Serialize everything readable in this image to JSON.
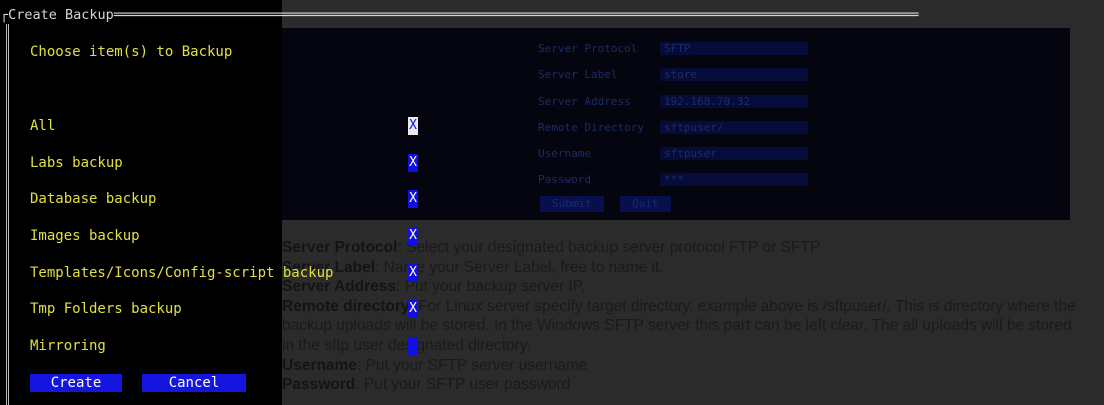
{
  "dialog": {
    "title_bar": "┌Create Backup═══════════════════════════════════════════════════════════════════════════════════════════════════",
    "heading": "Choose item(s) to Backup",
    "items": [
      {
        "label": "All",
        "mark": "X"
      },
      {
        "label": "Labs backup",
        "mark": "X"
      },
      {
        "label": "Database backup",
        "mark": "X"
      },
      {
        "label": "Images backup",
        "mark": "X"
      },
      {
        "label": "Templates/Icons/Config-script backup",
        "mark": "X"
      },
      {
        "label": "Tmp Folders backup",
        "mark": "X"
      },
      {
        "label": "Mirroring",
        "mark": ""
      }
    ],
    "create_label": "Create",
    "cancel_label": "Cancel"
  },
  "background_form": {
    "rows": [
      {
        "label": "Server Protocol",
        "value": "SFTP"
      },
      {
        "label": "Server Label",
        "value": "store"
      },
      {
        "label": "Server Address",
        "value": "192.168.70.32"
      },
      {
        "label": "Remote Directory",
        "value": "sftpuser/"
      },
      {
        "label": "Username",
        "value": "sftpuser"
      },
      {
        "label": "Password",
        "value": "***"
      }
    ],
    "submit_label": "Submit",
    "quit_label": "Quit"
  },
  "doc_text": {
    "p1_bold": "Server Protocol",
    "p1": ": Select your designated backup server protocol FTP or SFTP",
    "p2_bold": "Server Label",
    "p2": ": Name your Server Label, free to name it.",
    "p3_bold": "Server Address",
    "p3": ": Put your backup server IP,",
    "p4_bold": "Remote directory",
    "p4": ": For Linux server specify target directory, example above is /sftpuser/. This is directory where the backup uploads will be stored. In the Windows SFTP server this part can be left clear. The all uploads will be stored in the sftp user designated directory.",
    "p5_bold": "Username",
    "p5": ": Put your SFTP server username",
    "p6_bold": "Password",
    "p6": ": Put your SFTP user password"
  },
  "colors": {
    "item_text": "#e0e040",
    "checkbox": "#1010e6",
    "button": "#1515e0"
  }
}
